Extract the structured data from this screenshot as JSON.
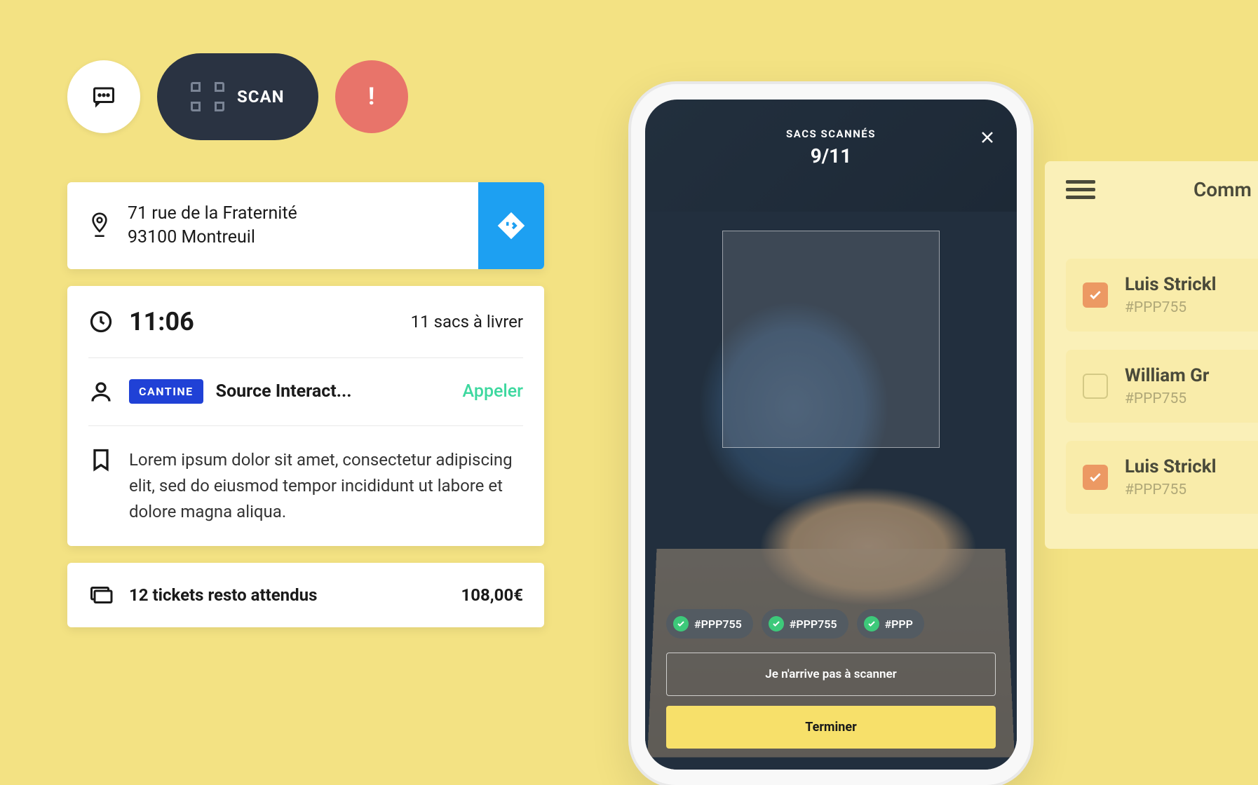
{
  "actions": {
    "scan_label": "SCAN"
  },
  "address": {
    "line1": "71 rue de la Fraternité",
    "line2": "93100 Montreuil"
  },
  "delivery": {
    "time": "11:06",
    "bags": "11 sacs à livrer",
    "tag": "CANTINE",
    "company": "Source Interact...",
    "call": "Appeler",
    "note": "Lorem ipsum dolor sit amet, consectetur adipiscing elit, sed do eiusmod tempor incididunt ut labore et dolore magna aliqua."
  },
  "tickets": {
    "text": "12 tickets resto attendus",
    "price": "108,00€"
  },
  "phone": {
    "header_title": "SACS SCANNÉS",
    "count": "9/11",
    "chips": [
      "#PPP755",
      "#PPP755",
      "#PPP"
    ],
    "fail_label": "Je n'arrive pas à scanner",
    "finish_label": "Terminer"
  },
  "right": {
    "title": "Comm",
    "contacts": [
      {
        "name": "Luis Strickl",
        "ref": "#PPP755",
        "checked": true
      },
      {
        "name": "William Gr",
        "ref": "#PPP755",
        "checked": false
      },
      {
        "name": "Luis Strickl",
        "ref": "#PPP755",
        "checked": true
      }
    ]
  }
}
